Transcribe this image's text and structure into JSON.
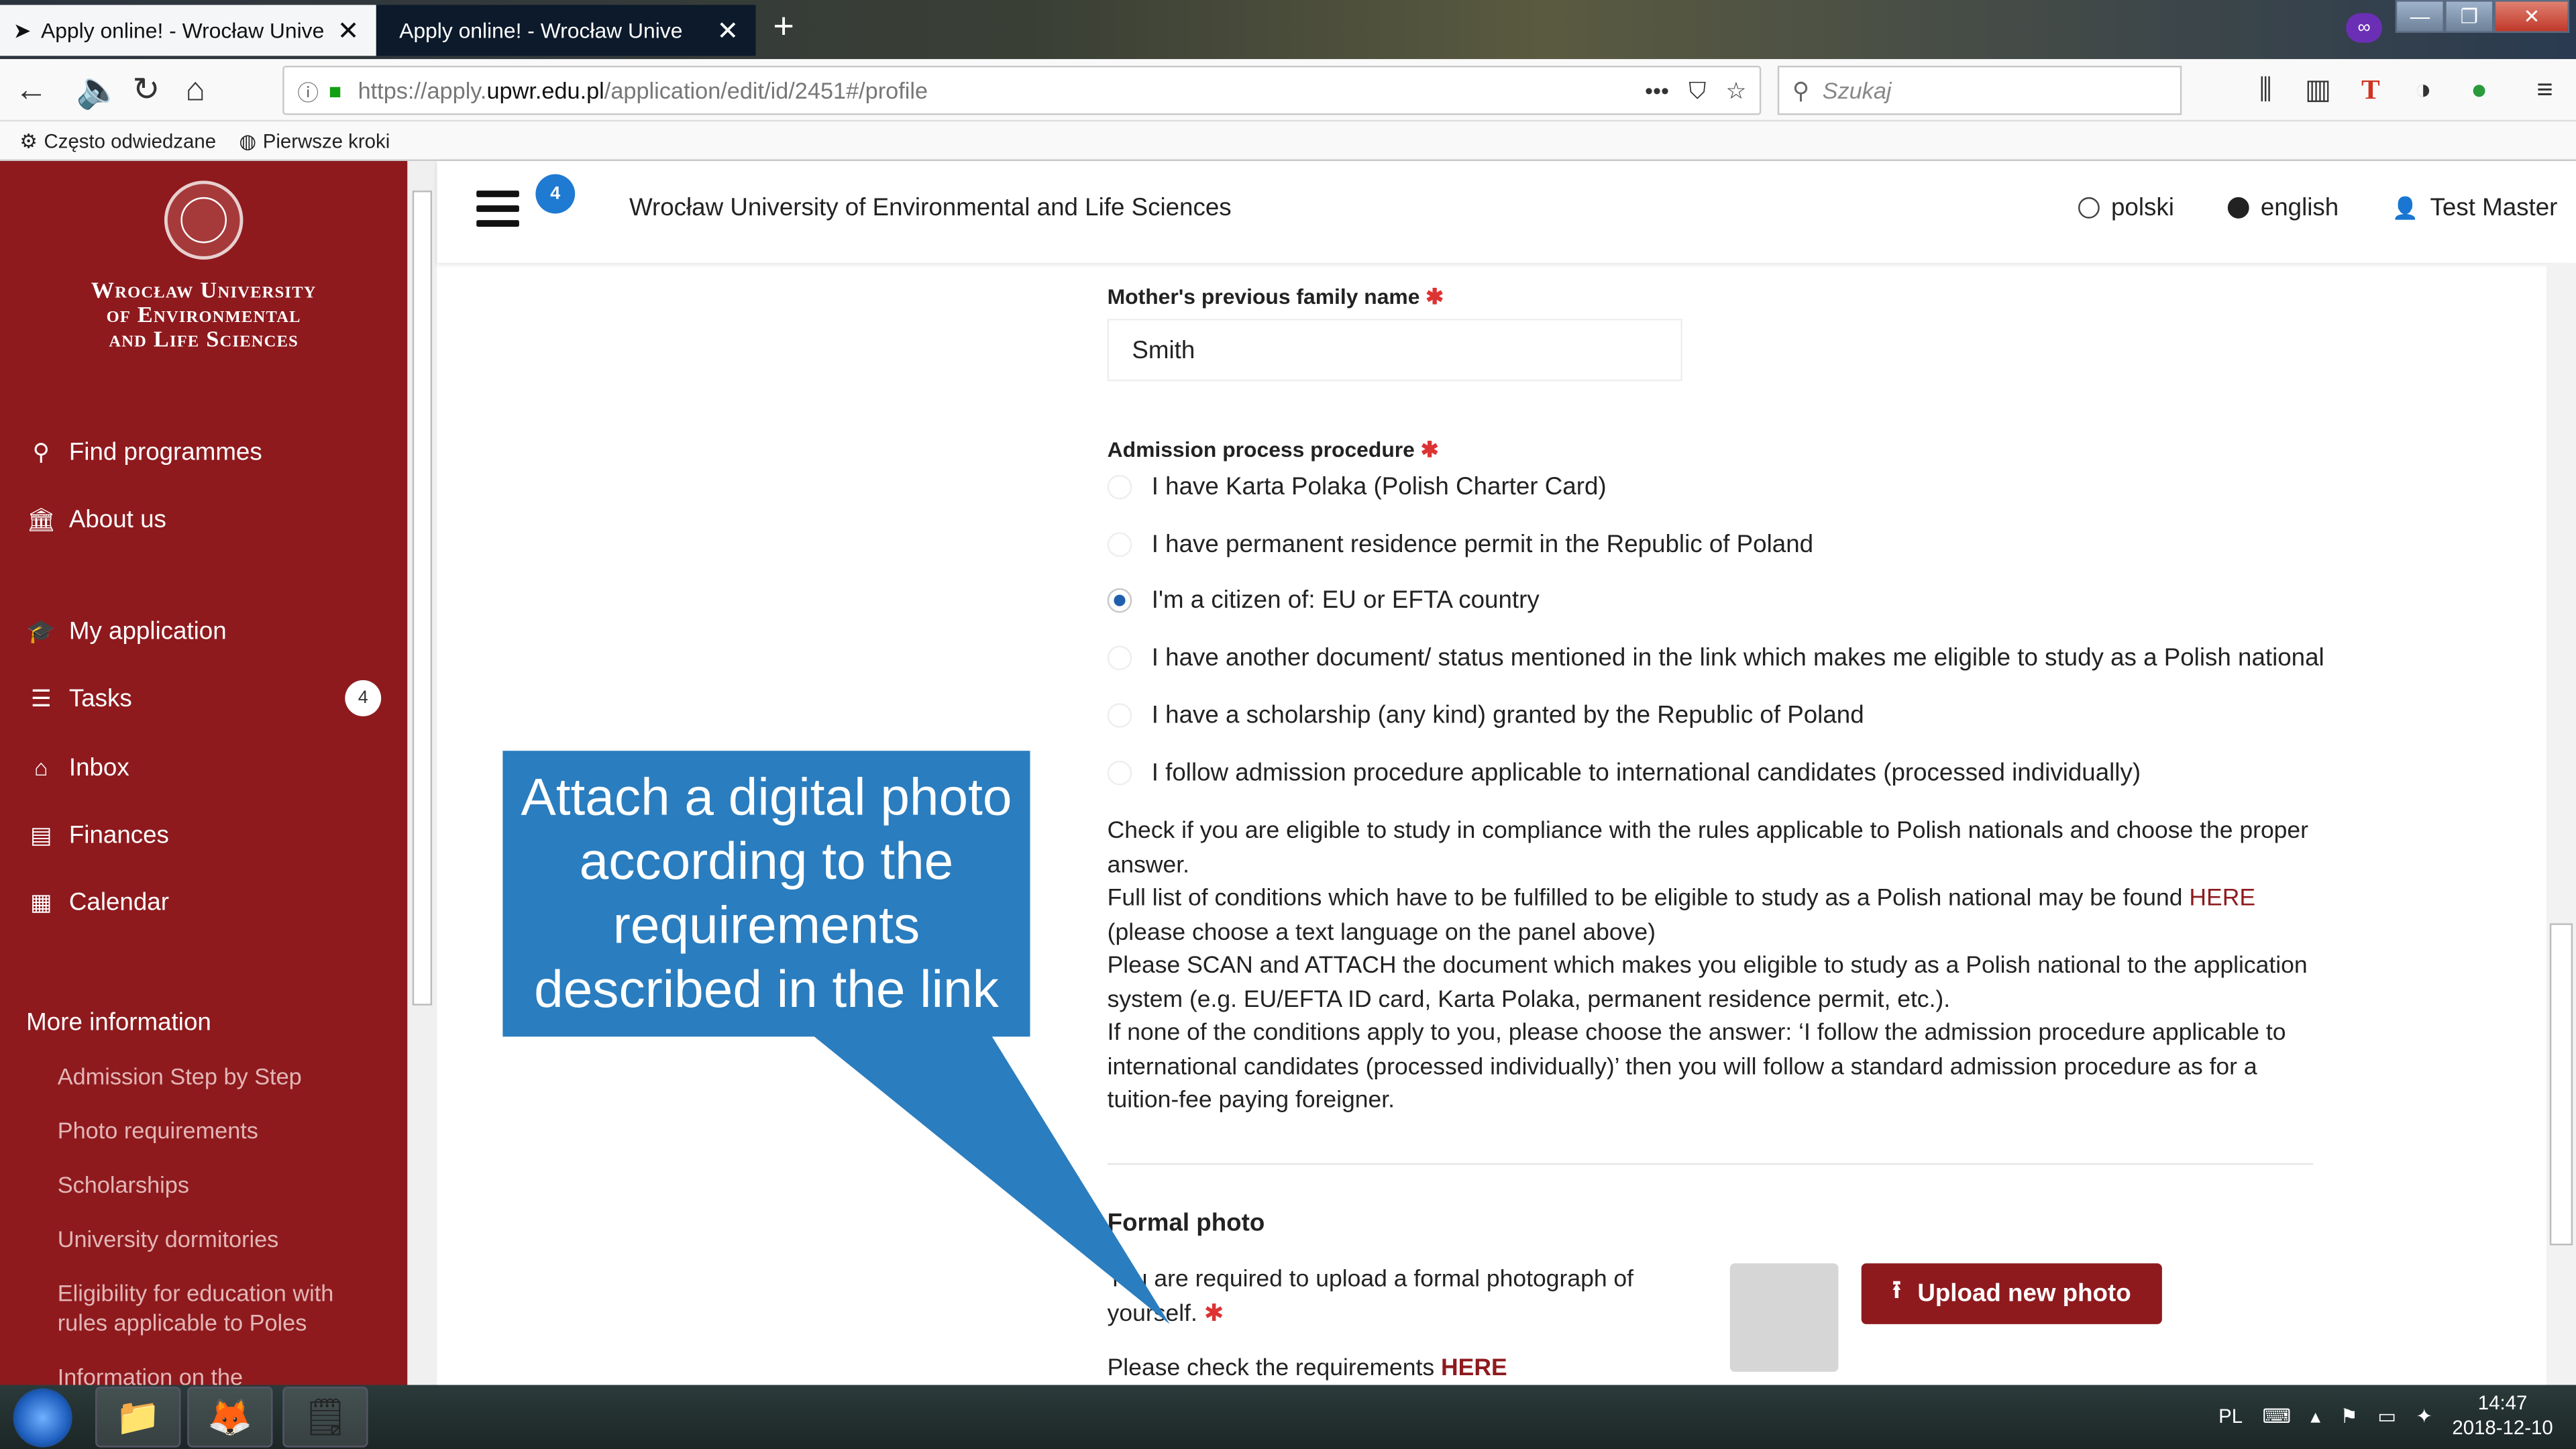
{
  "browser": {
    "tabs": [
      {
        "title": "Apply online! - Wrocław Unive",
        "close": "✕"
      },
      {
        "title": "Apply online! - Wrocław Unive",
        "close": "✕"
      }
    ],
    "new_tab": "+",
    "url": {
      "prefix": "https://apply.",
      "domain": "upwr.edu.pl",
      "path": "/application/edit/id/2451#/profile"
    },
    "url_menu": "•••",
    "search_placeholder": "Szukaj",
    "bookmarks": [
      {
        "label": "Często odwiedzane",
        "icon": "gear-icon"
      },
      {
        "label": "Pierwsze kroki",
        "icon": "globe-icon"
      }
    ],
    "window_controls": {
      "minimize": "—",
      "maximize": "❐",
      "close": "✕"
    }
  },
  "sidebar": {
    "university_name": "Wrocław University of Environmental and Life Sciences",
    "university_name_lines": [
      "Wrocław University",
      "of Environmental",
      "and Life Sciences"
    ],
    "nav": [
      {
        "label": "Find programmes",
        "icon": "search-icon"
      },
      {
        "label": "About us",
        "icon": "building-icon"
      },
      {
        "label": "My application",
        "icon": "graduation-cap-icon"
      },
      {
        "label": "Tasks",
        "icon": "tasks-icon",
        "badge": "4"
      },
      {
        "label": "Inbox",
        "icon": "inbox-icon"
      },
      {
        "label": "Finances",
        "icon": "document-icon"
      },
      {
        "label": "Calendar",
        "icon": "calendar-icon"
      }
    ],
    "more_info_title": "More information",
    "more_info_links": [
      "Admission Step by Step",
      "Photo requirements",
      "Scholarships",
      "University dormitories",
      "Eligibility for education with rules applicable to Poles",
      "Information on the"
    ]
  },
  "header": {
    "menu_badge": "4",
    "title": "Wrocław University of Environmental and Life Sciences",
    "languages": [
      {
        "label": "polski",
        "selected": false
      },
      {
        "label": "english",
        "selected": true
      }
    ],
    "user": "Test Master"
  },
  "form": {
    "mother_name_label": "Mother's previous family name",
    "mother_name_value": "Smith",
    "required_mark": "✱",
    "admission_label": "Admission process procedure",
    "admission_options": [
      {
        "label": "I have Karta Polaka (Polish Charter Card)",
        "selected": false
      },
      {
        "label": "I have permanent residence permit in the Republic of Poland",
        "selected": false
      },
      {
        "label": "I'm a citizen of: EU or EFTA country",
        "selected": true
      },
      {
        "label": "I have another document/ status mentioned in the link which makes me eligible to study as a Polish national",
        "selected": false
      },
      {
        "label": "I have a scholarship (any kind) granted by the Republic of Poland",
        "selected": false
      },
      {
        "label": "I follow admission procedure applicable to international candidates (processed individually)",
        "selected": false
      }
    ],
    "info": {
      "p1": "Check if you are eligible to study in compliance with the rules applicable to Polish nationals and choose the proper answer.",
      "p2_before": "Full list of conditions which have to be fulfilled to be eligible to study as a Polish national may be found ",
      "p2_link": "HERE",
      "p2_after": " (please choose a text language on the panel above)",
      "p3": "Please SCAN and ATTACH the document which makes you eligible to study as a Polish national to the application system (e.g. EU/EFTA ID card, Karta Polaka, permanent residence permit, etc.).",
      "p4": "If none of the conditions apply to you, please choose the answer: ‘I follow the admission procedure applicable to international candidates (processed individually)’ then you will follow a standard admission procedure as for a tuition-fee paying foreigner."
    },
    "photo": {
      "title": "Formal photo",
      "description": "You are required to upload a formal photograph of yourself.",
      "check_before": "Please check the requirements ",
      "check_link": "HERE",
      "upload_label": "Upload new photo"
    }
  },
  "callout": {
    "text": "Attach a digital photo according to the requirements described in the link"
  },
  "taskbar": {
    "language": "PL",
    "time": "14:47",
    "date": "2018-12-10"
  }
}
